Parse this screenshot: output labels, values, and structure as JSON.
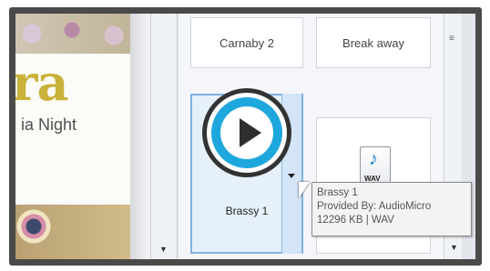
{
  "slide": {
    "big_text": "ra",
    "sub_text": "ia Night"
  },
  "gallery": {
    "items": [
      {
        "label": "Carnaby 2"
      },
      {
        "label": "Break away"
      },
      {
        "label": "Brassy 1"
      }
    ],
    "wav_icon_label": "WAV"
  },
  "tooltip": {
    "line1": "Brassy 1",
    "line2": "Provided By: AudioMicro",
    "line3": "12296 KB | WAV"
  },
  "icons": {
    "play": "play-icon",
    "wav": "wav-file-icon",
    "cursor": "mouse-cursor-icon",
    "dropdown": "caret-down-icon"
  },
  "colors": {
    "accent_blue": "#1ea7dd",
    "selection_border": "#7fb2e3",
    "slide_gold": "#c9b23a"
  }
}
